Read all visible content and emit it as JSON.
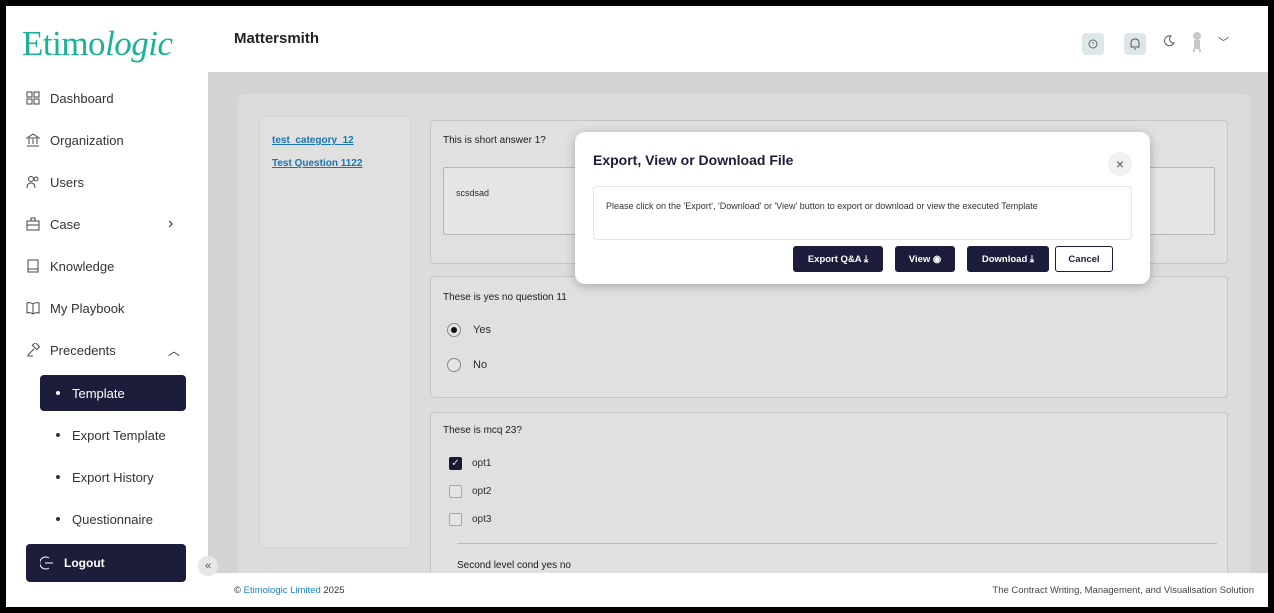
{
  "brand": {
    "logo_regular": "Etimo",
    "logo_italic": "logic"
  },
  "header": {
    "title": "Mattersmith"
  },
  "sidebar": {
    "items": [
      {
        "label": "Dashboard"
      },
      {
        "label": "Organization"
      },
      {
        "label": "Users"
      },
      {
        "label": "Case",
        "chevron": ">"
      },
      {
        "label": "Knowledge"
      },
      {
        "label": "My Playbook"
      },
      {
        "label": "Precedents",
        "chevron": "^"
      }
    ],
    "sub_items": [
      {
        "label": "Template",
        "active": true
      },
      {
        "label": "Export Template"
      },
      {
        "label": "Export History"
      },
      {
        "label": "Questionnaire"
      }
    ],
    "logout": "Logout",
    "collapse": "«"
  },
  "question_nav": {
    "links": [
      "test_category_12",
      "Test Question 1122"
    ]
  },
  "questions": {
    "q1": {
      "title": "This is short answer 1?",
      "answer": "scsdsad"
    },
    "q2": {
      "title": "These is yes no question 11",
      "options": [
        "Yes",
        "No"
      ],
      "selected": "Yes"
    },
    "q3": {
      "title": "These is mcq 23?",
      "options": [
        "opt1",
        "opt2",
        "opt3"
      ],
      "checked": [
        "opt1"
      ],
      "sub_title": "Second level cond yes no"
    }
  },
  "modal": {
    "title": "Export, View or Download File",
    "close": "×",
    "body": "Please click on the 'Export', 'Download' or 'View' button to export or download or view the executed Template",
    "buttons": {
      "export": "Export Q&A ⤓",
      "view": "View ◉",
      "download": "Download ⤓",
      "cancel": "Cancel"
    }
  },
  "footer": {
    "copyright_symbol": "©",
    "company": "Etimologic Limited",
    "year": "2025",
    "tagline": "The Contract Writing, Management, and Visualisation Solution"
  },
  "colors": {
    "brand": "#1ab39a",
    "navy": "#1b1d3a",
    "link": "#1c84c6"
  }
}
